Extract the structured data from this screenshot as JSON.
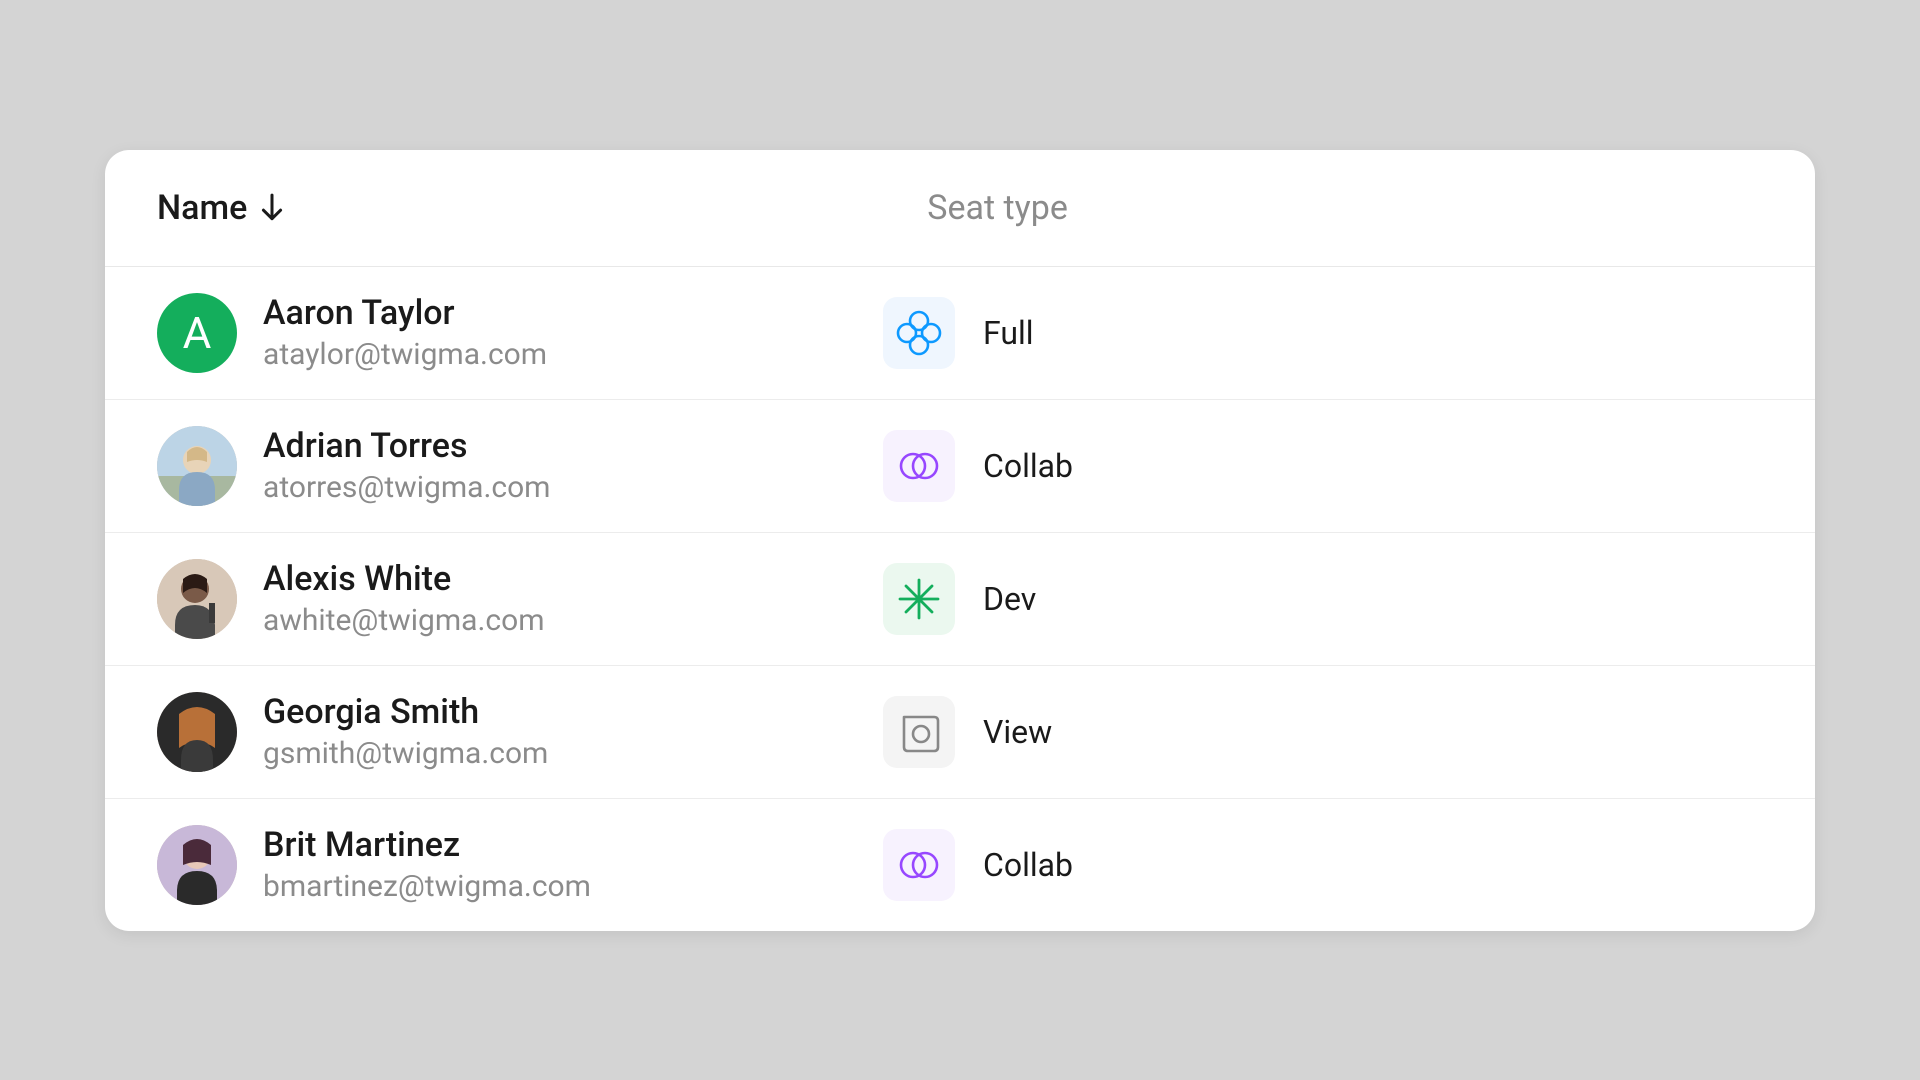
{
  "columns": {
    "name": "Name",
    "seat_type": "Seat type"
  },
  "sort": {
    "column": "name",
    "direction": "asc"
  },
  "rows": [
    {
      "name": "Aaron Taylor",
      "email": "ataylor@twigma.com",
      "avatar_kind": "initial",
      "avatar_initial": "A",
      "avatar_bg": "#14ae5c",
      "seat": {
        "label": "Full",
        "icon": "full",
        "icon_color": "#0d99ff",
        "icon_bg": "#eff6fe"
      }
    },
    {
      "name": "Adrian Torres",
      "email": "atorres@twigma.com",
      "avatar_kind": "photo",
      "seat": {
        "label": "Collab",
        "icon": "collab",
        "icon_color": "#9747ff",
        "icon_bg": "#f7f2fe"
      }
    },
    {
      "name": "Alexis White",
      "email": "awhite@twigma.com",
      "avatar_kind": "photo",
      "seat": {
        "label": "Dev",
        "icon": "dev",
        "icon_color": "#14ae5c",
        "icon_bg": "#ebf8ef"
      }
    },
    {
      "name": "Georgia Smith",
      "email": "gsmith@twigma.com",
      "avatar_kind": "photo",
      "seat": {
        "label": "View",
        "icon": "view",
        "icon_color": "#888888",
        "icon_bg": "#f4f4f4"
      }
    },
    {
      "name": "Brit Martinez",
      "email": "bmartinez@twigma.com",
      "avatar_kind": "photo",
      "seat": {
        "label": "Collab",
        "icon": "collab",
        "icon_color": "#9747ff",
        "icon_bg": "#f7f2fe"
      }
    }
  ]
}
